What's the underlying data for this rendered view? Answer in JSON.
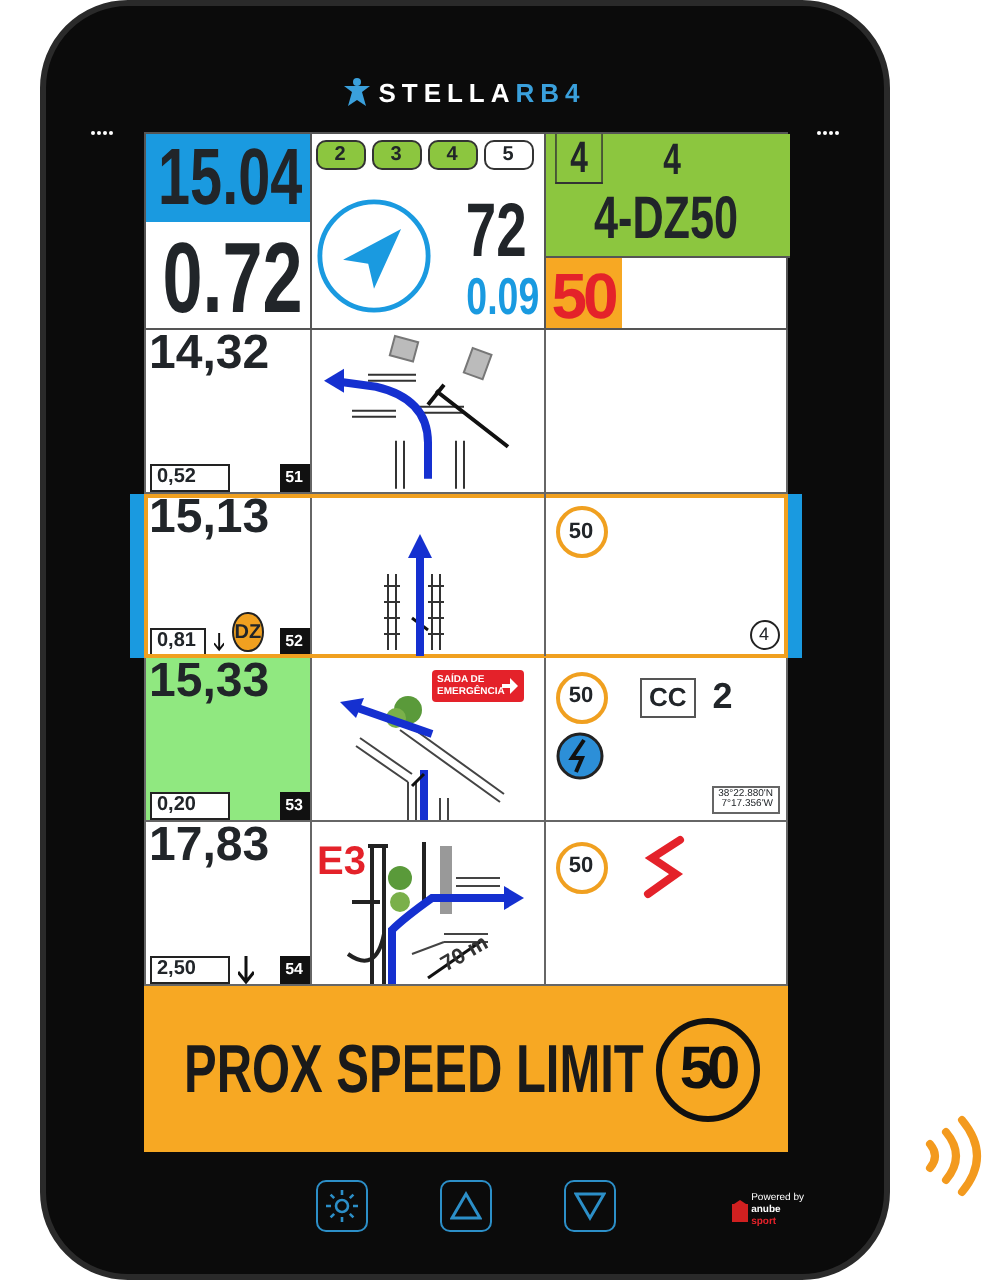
{
  "device": {
    "brand": "STELLA",
    "brand_suffix": "RB4",
    "powered_by": "Powered by",
    "maker": "anube",
    "maker_suffix": "sport"
  },
  "header": {
    "total": "15.04",
    "partial": "0.72",
    "cap_badges": [
      {
        "label": "2",
        "done": true
      },
      {
        "label": "3",
        "done": true
      },
      {
        "label": "4",
        "done": true
      },
      {
        "label": "5",
        "done": false
      }
    ],
    "heading": "72",
    "cap_error": "0.09",
    "zone_boxes": [
      "4",
      "4"
    ],
    "zone": "4-DZ50",
    "speed_limit": "50"
  },
  "rows": [
    {
      "total": "14,32",
      "partial": "0,52",
      "number": "51",
      "selected": false,
      "highlight": false,
      "arrow_down": false,
      "notes": []
    },
    {
      "total": "15,13",
      "partial": "0,81",
      "number": "52",
      "selected": true,
      "highlight": false,
      "arrow_down": true,
      "marker": "DZ",
      "notes": [
        {
          "kind": "speed",
          "text": "50"
        },
        {
          "kind": "count",
          "text": "4"
        }
      ]
    },
    {
      "total": "15,33",
      "partial": "0,20",
      "number": "53",
      "selected": false,
      "highlight": true,
      "arrow_down": false,
      "sign": "SAÍDA DE EMERGÊNCIA",
      "notes": [
        {
          "kind": "speed",
          "text": "50"
        },
        {
          "kind": "cc",
          "text": "CC"
        },
        {
          "kind": "number",
          "text": "2"
        },
        {
          "kind": "hazard"
        },
        {
          "kind": "gps",
          "text": "38°22.880'N",
          "text2": "7°17.356'W"
        }
      ]
    },
    {
      "total": "17,83",
      "partial": "2,50",
      "number": "54",
      "selected": false,
      "highlight": false,
      "arrow_down": true,
      "tulip_labels": [
        {
          "kind": "waypoint",
          "text": "E3"
        },
        {
          "kind": "distance",
          "text": "70 m"
        }
      ],
      "notes": [
        {
          "kind": "speed",
          "text": "50"
        },
        {
          "kind": "curve"
        }
      ]
    }
  ],
  "banner": {
    "text": "PROX SPEED LIMIT",
    "speed": "50"
  },
  "controls": [
    {
      "kind": "brightness"
    },
    {
      "kind": "up"
    },
    {
      "kind": "down"
    }
  ]
}
